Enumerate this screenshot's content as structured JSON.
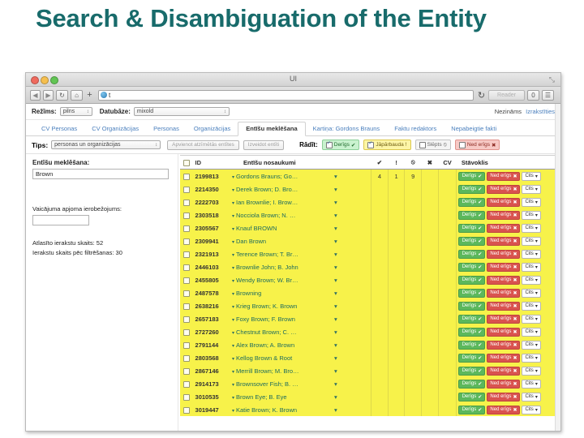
{
  "slide": {
    "title": "Search & Disambiguation of the Entity",
    "title_color": "#186b6b"
  },
  "browser": {
    "window_title": "UI",
    "url_text": "t",
    "reader_label": "Reader",
    "back_icon": "◀",
    "forward_icon": "▶",
    "reload_icon": "↻",
    "home_icon": "⌂",
    "new_tab_icon": "+",
    "refresh_icon": "↻",
    "share_icon": "0",
    "tabs_icon": "☰",
    "fullscreen_icon": "⤡"
  },
  "modebar": {
    "mode_label": "Režīms:",
    "mode_value": "pilns",
    "db_label": "Datubāze:",
    "db_value": "mixold",
    "user": "Nezināms",
    "logout": "Izrakstīties",
    "caret": "↕"
  },
  "tabs": [
    {
      "label": "CV Personas",
      "active": false
    },
    {
      "label": "CV Organizācijas",
      "active": false
    },
    {
      "label": "Personas",
      "active": false
    },
    {
      "label": "Organizācijas",
      "active": false
    },
    {
      "label": "Entīšu meklēšana",
      "active": true
    },
    {
      "label": "Kartiņa: Gordons Brauns",
      "active": false
    },
    {
      "label": "Faktu redaktors",
      "active": false
    },
    {
      "label": "Nepabeigtie fakti",
      "active": false
    }
  ],
  "filterbar": {
    "tips_label": "Tips:",
    "tips_value": "personas un organizācijas",
    "merge_button": "Apvienot atzīmētās entītes",
    "create_button": "Izveidot entīti",
    "show_label": "Rādīt:",
    "filters": [
      {
        "label": "Derīgs",
        "icon": "✔",
        "checked": true,
        "style": "green"
      },
      {
        "label": "Jāpārbauda",
        "icon": "!",
        "checked": true,
        "style": "yellow"
      },
      {
        "label": "Slēpts",
        "icon": "⦸",
        "checked": false,
        "style": "gray"
      },
      {
        "label": "Ned erīgs",
        "icon": "✖",
        "checked": false,
        "style": "red"
      }
    ],
    "filter_invalid_label": "Ned erīgs"
  },
  "sidebar": {
    "search_label": "Entīšu meklēšana:",
    "search_value": "Brown",
    "limit_label": "Vaicājuma apjoma ierobežojums:",
    "limit_value": "",
    "selected_count": "Atlasīto ierakstu skaits: 52",
    "filtered_count": "Ierakstu skaits pēc filtrēšanas: 30"
  },
  "table": {
    "headers": {
      "id": "ID",
      "names": "Entīšu nosaukumi",
      "check": "✔",
      "exclaim": "!",
      "hidden": "⦸",
      "cross": "✖",
      "cv": "CV",
      "state": "Stāvoklis"
    },
    "state_buttons": {
      "valid": "Derīgs",
      "valid_icon": "✔",
      "invalid": "Ned erīgs",
      "invalid_icon": "✖",
      "other": "Cits",
      "other_icon": "▾"
    },
    "row_caret": "▾",
    "rows": [
      {
        "id": "2199813",
        "name": "Gordons Brauns; Gordon Brown; ...",
        "check": "4",
        "exclaim": "1",
        "hidden": "9",
        "cross": "",
        "cv": ""
      },
      {
        "id": "2214350",
        "name": "Derek Brown; D. Brown",
        "check": "",
        "exclaim": "",
        "hidden": "",
        "cross": "",
        "cv": ""
      },
      {
        "id": "2222703",
        "name": "Ian Brownlie; I. Brownlie",
        "check": "",
        "exclaim": "",
        "hidden": "",
        "cross": "",
        "cv": ""
      },
      {
        "id": "2303518",
        "name": "Nocciola Brown; N. Brown",
        "check": "",
        "exclaim": "",
        "hidden": "",
        "cross": "",
        "cv": ""
      },
      {
        "id": "2305567",
        "name": "Knauf BROWN",
        "check": "",
        "exclaim": "",
        "hidden": "",
        "cross": "",
        "cv": ""
      },
      {
        "id": "2309941",
        "name": "Dan Brown",
        "check": "",
        "exclaim": "",
        "hidden": "",
        "cross": "",
        "cv": ""
      },
      {
        "id": "2321913",
        "name": "Terence Brown; T. Brown",
        "check": "",
        "exclaim": "",
        "hidden": "",
        "cross": "",
        "cv": ""
      },
      {
        "id": "2446103",
        "name": "Brownlie John; B. John",
        "check": "",
        "exclaim": "",
        "hidden": "",
        "cross": "",
        "cv": ""
      },
      {
        "id": "2455805",
        "name": "Wendy Brown; W. Brown",
        "check": "",
        "exclaim": "",
        "hidden": "",
        "cross": "",
        "cv": ""
      },
      {
        "id": "2487578",
        "name": "Browning",
        "check": "",
        "exclaim": "",
        "hidden": "",
        "cross": "",
        "cv": ""
      },
      {
        "id": "2638216",
        "name": "Krieg Brown; K. Brown",
        "check": "",
        "exclaim": "",
        "hidden": "",
        "cross": "",
        "cv": ""
      },
      {
        "id": "2657183",
        "name": "Foxy Brown; F. Brown",
        "check": "",
        "exclaim": "",
        "hidden": "",
        "cross": "",
        "cv": ""
      },
      {
        "id": "2727260",
        "name": "Chestnut Brown; C. Brown",
        "check": "",
        "exclaim": "",
        "hidden": "",
        "cross": "",
        "cv": ""
      },
      {
        "id": "2791144",
        "name": "Alex Brown; A. Brown",
        "check": "",
        "exclaim": "",
        "hidden": "",
        "cross": "",
        "cv": ""
      },
      {
        "id": "2803568",
        "name": "Kellog Brown & Root",
        "check": "",
        "exclaim": "",
        "hidden": "",
        "cross": "",
        "cv": ""
      },
      {
        "id": "2867146",
        "name": "Merrill Brown; M. Brown",
        "check": "",
        "exclaim": "",
        "hidden": "",
        "cross": "",
        "cv": ""
      },
      {
        "id": "2914173",
        "name": "Brownsover Fish; B. Fish",
        "check": "",
        "exclaim": "",
        "hidden": "",
        "cross": "",
        "cv": ""
      },
      {
        "id": "3010535",
        "name": "Brown Eye; B. Eye",
        "check": "",
        "exclaim": "",
        "hidden": "",
        "cross": "",
        "cv": ""
      },
      {
        "id": "3019447",
        "name": "Katie Brown; K. Brown",
        "check": "",
        "exclaim": "",
        "hidden": "",
        "cross": "",
        "cv": ""
      }
    ]
  },
  "colors": {
    "row_highlight": "#f7f24a",
    "valid_green": "#5cb85c",
    "invalid_red": "#d9534f",
    "link_blue": "#4a7fbd",
    "title_teal": "#186b6b"
  }
}
